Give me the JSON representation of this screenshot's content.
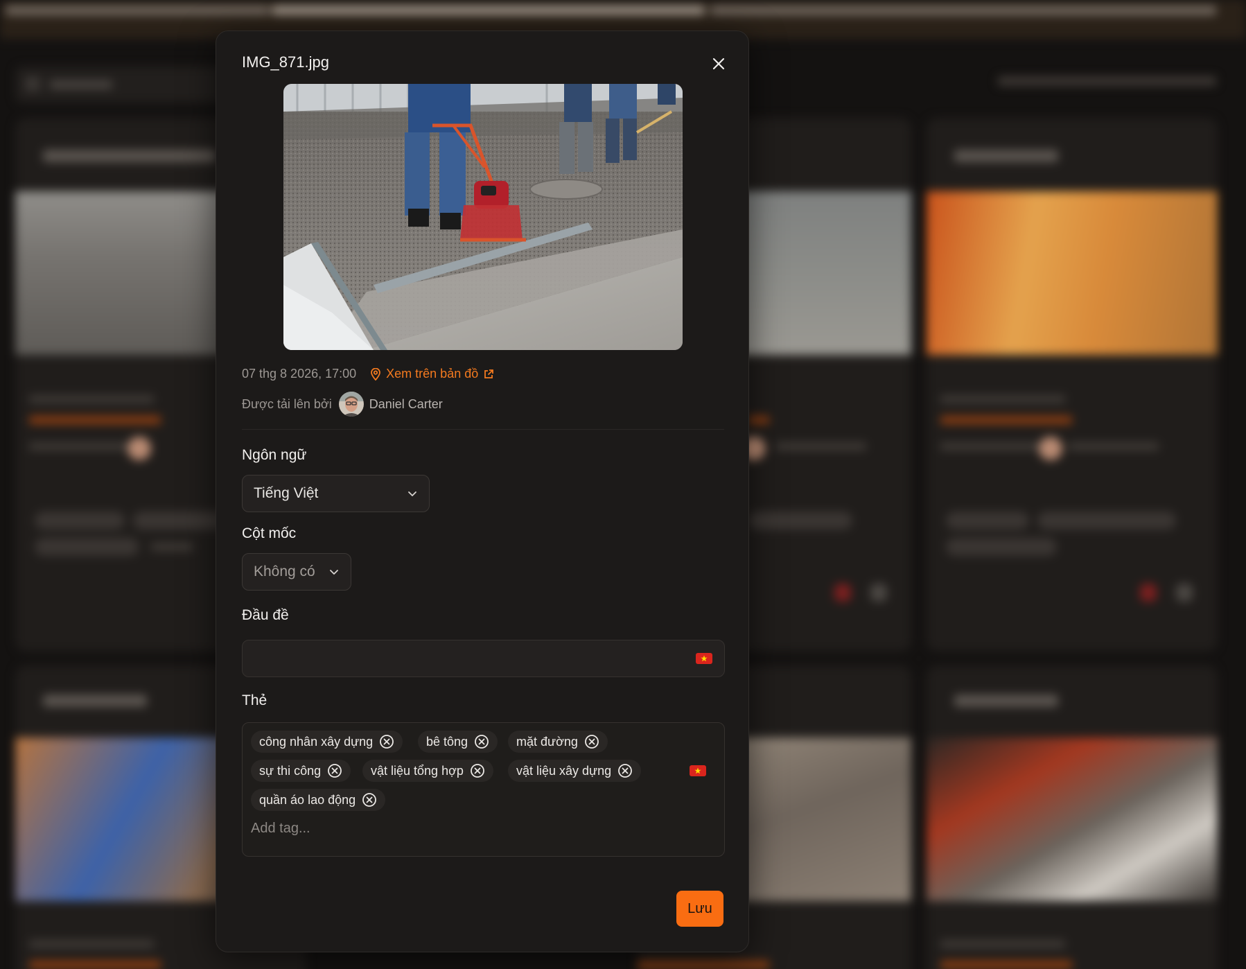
{
  "modal": {
    "filename": "IMG_871.jpg",
    "date": "07 thg 8 2026, 17:00",
    "map_link": "Xem trên bản đồ",
    "uploaded_by_label": "Được tải lên bởi",
    "uploader_name": "Daniel Carter",
    "language": {
      "label": "Ngôn ngữ",
      "value": "Tiếng Việt"
    },
    "milestone": {
      "label": "Cột mốc",
      "value": "Không có"
    },
    "title_field": {
      "label": "Đầu đề",
      "value": ""
    },
    "tags": {
      "label": "Thẻ",
      "items": [
        "công nhân xây dựng",
        "bê tông",
        "mặt đường",
        "sự thi công",
        "vật liệu tổng hợp",
        "vật liệu xây dựng",
        "quần áo lao động"
      ],
      "placeholder": "Add tag..."
    },
    "save_label": "Lưu"
  },
  "colors": {
    "accent": "#f96d12",
    "link": "#f47a1f",
    "flag_red": "#da251d",
    "flag_star": "#ffdd00"
  },
  "icons": [
    "close-icon",
    "location-pin-icon",
    "external-link-icon",
    "chevron-down-icon",
    "remove-tag-icon",
    "vietnam-flag-icon"
  ]
}
